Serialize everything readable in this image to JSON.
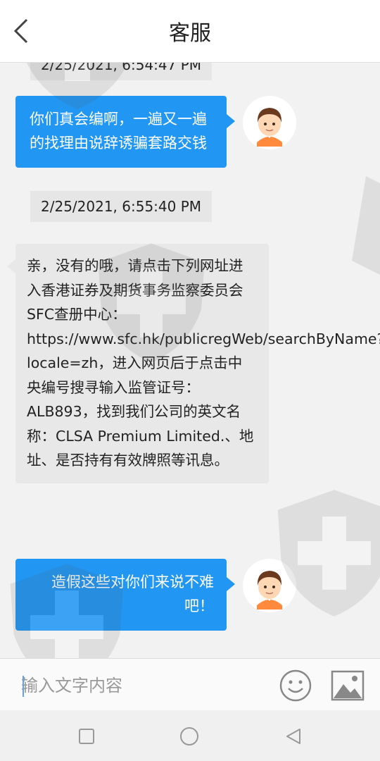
{
  "header": {
    "title": "客服"
  },
  "messages": {
    "ts_top": "2/25/2021, 6:54:47 PM",
    "user1_line1": "你们真会编啊，一遍又一遍",
    "user1_line2": "的找理由说辞诱骗套路交钱",
    "ts_mid": "2/25/2021, 6:55:40 PM",
    "agent_lines": [
      "亲，没有的哦，请点击下列网址进",
      "入香港证券及期货事务监察委员会",
      "SFC查册中心：",
      "https://www.sfc.hk/publicregWeb/searchByName?",
      "locale=zh，进入网页后于点击中",
      "央编号搜寻输入监管证号：",
      "ALB893，找到我们公司的英文名",
      "称：CLSA Premium Limited.、地",
      "址、是否持有有效牌照等讯息。"
    ],
    "user2_line1": "造假这些对你们来说不难",
    "user2_line2": "吧！"
  },
  "input": {
    "placeholder": "输入文字内容"
  },
  "colors": {
    "user_bubble": "#2196f3",
    "agent_bubble": "#e8e8e8",
    "header_bg": "#ffffff"
  },
  "icons": [
    "back-arrow-icon",
    "avatar-icon",
    "emoji-icon",
    "image-icon",
    "square-nav-icon",
    "circle-nav-icon",
    "triangle-back-icon",
    "shield-watermark-icon"
  ]
}
